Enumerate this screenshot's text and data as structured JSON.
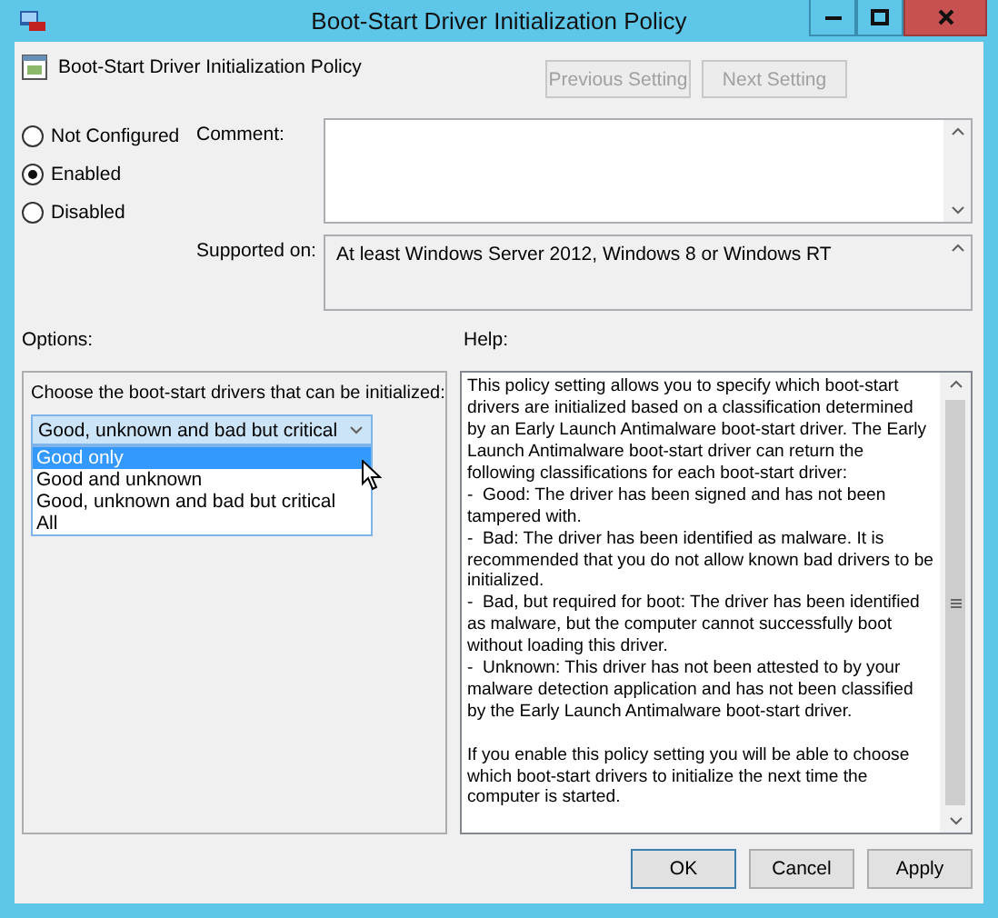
{
  "window": {
    "title": "Boot-Start Driver Initialization Policy"
  },
  "header": {
    "title": "Boot-Start Driver Initialization Policy"
  },
  "nav_buttons": [
    {
      "label": "Previous Setting",
      "disabled": true
    },
    {
      "label": "Next Setting",
      "disabled": true
    }
  ],
  "state_options": [
    {
      "label": "Not Configured",
      "selected": false
    },
    {
      "label": "Enabled",
      "selected": true
    },
    {
      "label": "Disabled",
      "selected": false
    }
  ],
  "comment": {
    "label": "Comment:"
  },
  "supported_on": {
    "label": "Supported on:",
    "value": "At least Windows Server 2012, Windows 8 or Windows RT"
  },
  "options": {
    "label": "Options:",
    "prompt": "Choose the boot-start drivers that can be initialized:",
    "dropdown": {
      "value": "Good, unknown and bad but critical",
      "expanded": true,
      "items": [
        {
          "label": "Good only",
          "highlighted": true
        },
        {
          "label": "Good and unknown",
          "highlighted": false
        },
        {
          "label": "Good, unknown and bad but critical",
          "highlighted": false
        },
        {
          "label": "All",
          "highlighted": false
        }
      ]
    }
  },
  "help": {
    "label": "Help:",
    "paragraphs": [
      "This policy setting allows you to specify which boot-start drivers are initialized based on a classification determined by an Early Launch Antimalware boot-start driver. The Early Launch Antimalware boot-start driver can return the following classifications for each boot-start driver:",
      "-  Good: The driver has been signed and has not been tampered with.",
      "-  Bad: The driver has been identified as malware. It is recommended that you do not allow known bad drivers to be initialized.",
      "-  Bad, but required for boot: The driver has been identified as malware, but the computer cannot successfully boot without loading this driver.",
      "-  Unknown: This driver has not been attested to by your malware detection application and has not been classified by the Early Launch Antimalware boot-start driver.",
      "If you enable this policy setting you will be able to choose which boot-start drivers to initialize the next time the computer is started."
    ]
  },
  "dialog_buttons": [
    {
      "label": "OK",
      "default": true
    },
    {
      "label": "Cancel",
      "default": false
    },
    {
      "label": "Apply",
      "default": false
    }
  ]
}
